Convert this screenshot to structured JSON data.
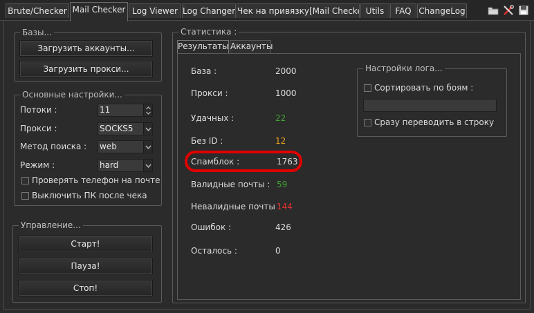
{
  "tabs": [
    {
      "label": "Brute/Checker",
      "active": false
    },
    {
      "label": "Mail Checker",
      "active": true
    },
    {
      "label": "Log  Viewer",
      "active": false
    },
    {
      "label": "Log Changer",
      "active": false
    },
    {
      "label": "Чек на привязку[Mail Checker]",
      "active": false
    },
    {
      "label": "Utils",
      "active": false
    },
    {
      "label": "FAQ",
      "active": false
    },
    {
      "label": "ChangeLog",
      "active": false
    }
  ],
  "toolbar_icons": [
    "folder-icon",
    "tools-icon",
    "save-icon"
  ],
  "bases": {
    "title": "Базы...",
    "load_accounts": "Загрузить аккаунты...",
    "load_proxies": "Загрузить прокси..."
  },
  "settings": {
    "title": "Основные настройки...",
    "threads_label": "Потоки :",
    "threads_value": "11",
    "proxy_label": "Прокси :",
    "proxy_value": "SOCKS5",
    "search_label": "Метод поиска :",
    "search_value": "web",
    "mode_label": "Режим  :",
    "mode_value": "hard",
    "check_phone": "Проверять телефон на почте",
    "shutdown_pc": "Выключить ПК после чека"
  },
  "control": {
    "title": "Управление...",
    "start": "Старт!",
    "pause": "Пауза!",
    "stop": "Стоп!"
  },
  "stats": {
    "title": "Статистика :",
    "tab_results": "Результаты",
    "tab_accounts": "Аккаунты",
    "rows": [
      {
        "name": "База :",
        "value": "2000",
        "color": "#dcdcdc"
      },
      {
        "name": "Прокси :",
        "value": "1000",
        "color": "#dcdcdc"
      },
      {
        "name": "Удачных :",
        "value": "22",
        "color": "#3fa535"
      },
      {
        "name": "Без ID :",
        "value": "12",
        "color": "#e8a020"
      },
      {
        "name": "Спамблок :",
        "value": "1763",
        "color": "#dcdcdc"
      },
      {
        "name": "Валидные почты :",
        "value": "59",
        "color": "#3fa535"
      },
      {
        "name": "Невалидные почты :",
        "value": "144",
        "color": "#e03030"
      },
      {
        "name": "Ошибок :",
        "value": "426",
        "color": "#dcdcdc"
      },
      {
        "name": "Осталось :",
        "value": "0",
        "color": "#dcdcdc"
      }
    ],
    "highlight_color": "#e00000"
  },
  "log_settings": {
    "title": "Настройки лога...",
    "sort_by_fights": "Сортировать по боям :",
    "to_line": "Сразу переводить в строку"
  }
}
